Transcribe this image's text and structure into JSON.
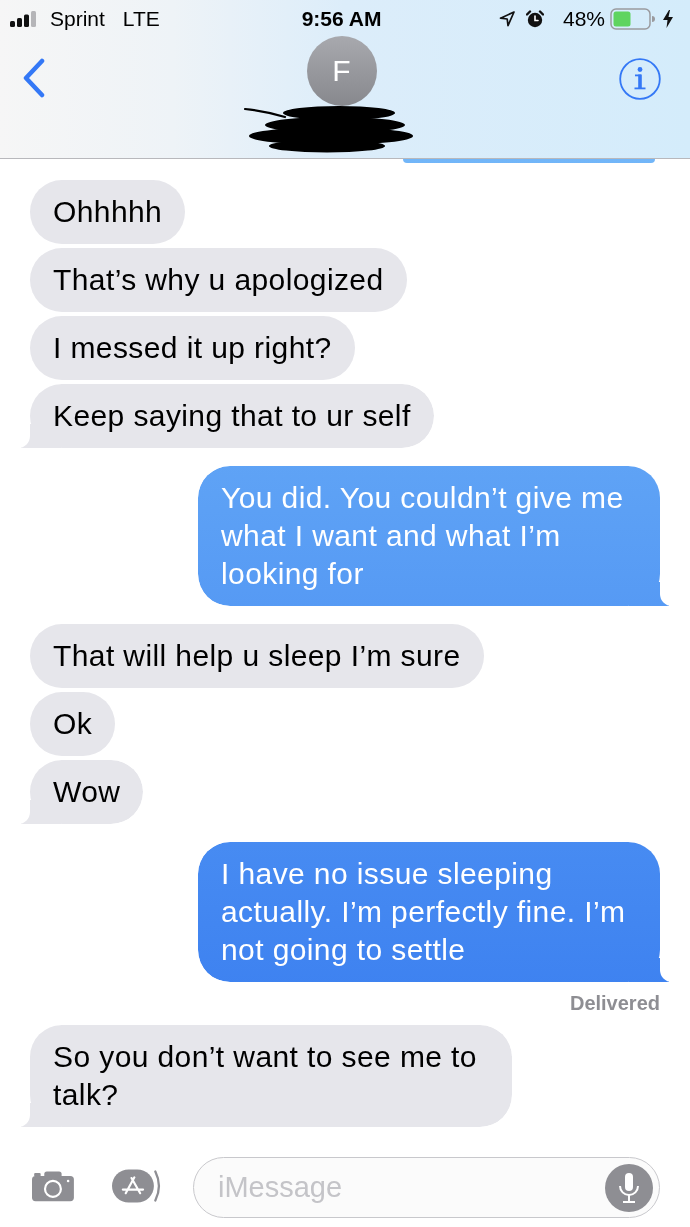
{
  "status_bar": {
    "carrier": "Sprint",
    "network": "LTE",
    "time": "9:56 AM",
    "battery": "48%"
  },
  "header": {
    "avatar_initial": "F"
  },
  "messages": [
    {
      "kind": "received",
      "text": "Ohhhhh",
      "tail": false
    },
    {
      "kind": "received",
      "text": "That’s why u apologized",
      "tail": false
    },
    {
      "kind": "received",
      "text": "I messed it up right?",
      "tail": false
    },
    {
      "kind": "received",
      "text": "Keep saying that to ur self",
      "tail": true
    },
    {
      "kind": "sent",
      "text": "You did. You couldn’t give me what I want and what I’m looking for",
      "tail": true
    },
    {
      "kind": "received",
      "text": "That will help u sleep I’m sure",
      "tail": false
    },
    {
      "kind": "received",
      "text": "Ok",
      "tail": false
    },
    {
      "kind": "received",
      "text": "Wow",
      "tail": true
    },
    {
      "kind": "sent",
      "text": "I have no issue sleeping actually. I’m perfectly fine. I’m not going to settle",
      "tail": true,
      "receipt": "Delivered"
    },
    {
      "kind": "received",
      "text": "So you don’t want to see me to talk?",
      "tail": true
    }
  ],
  "composer": {
    "placeholder": "iMessage"
  }
}
